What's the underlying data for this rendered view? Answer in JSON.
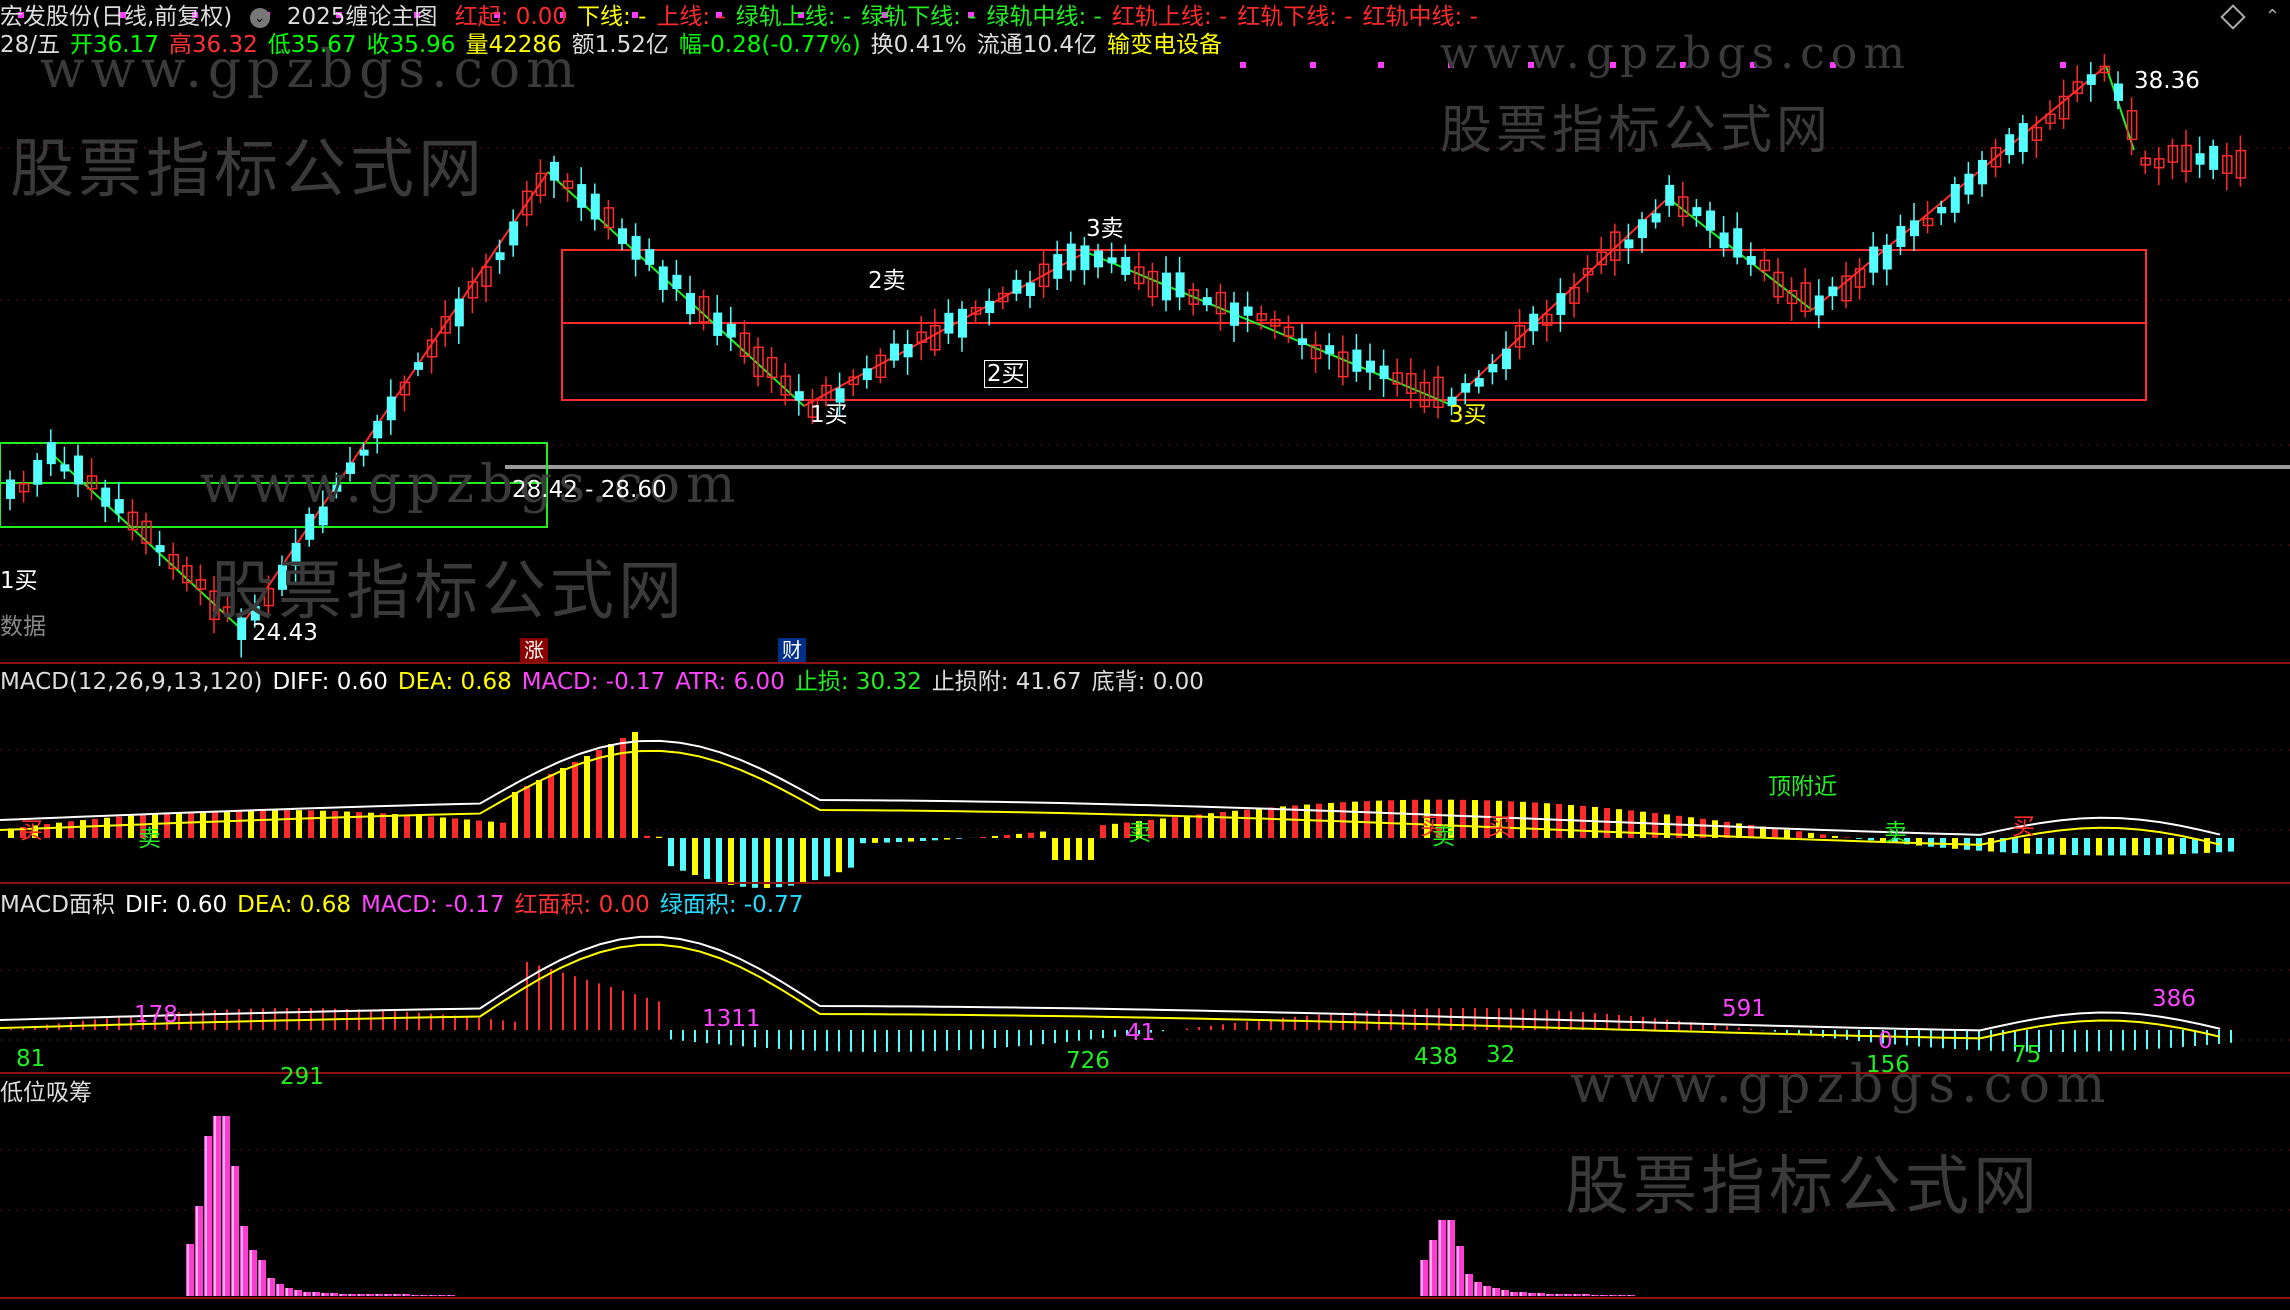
{
  "title_bar": {
    "stock_name": "宏发股份(日线,前复权)",
    "indicator": "2025缠论主图",
    "params": [
      {
        "text": "红起: 0.00",
        "color": "#ff2a2a"
      },
      {
        "text": "下线: -",
        "color": "#ffff00"
      },
      {
        "text": "上线: -",
        "color": "#ff2a2a"
      },
      {
        "text": "绿轨上线: -",
        "color": "#22ee22"
      },
      {
        "text": "绿轨下线: -",
        "color": "#22ee22"
      },
      {
        "text": "绿轨中线: -",
        "color": "#22ee22"
      },
      {
        "text": "红轨上线: -",
        "color": "#ff2a2a"
      },
      {
        "text": "红轨下线: -",
        "color": "#ff2a2a"
      },
      {
        "text": "红轨中线: -",
        "color": "#ff2a2a"
      }
    ]
  },
  "quote_bar": [
    {
      "text": "28/五",
      "color": "#dddddd"
    },
    {
      "text": "开36.17",
      "color": "#00ff00"
    },
    {
      "text": "高36.32",
      "color": "#ff3333"
    },
    {
      "text": "低35.67",
      "color": "#00ff00"
    },
    {
      "text": "收35.96",
      "color": "#00ff00"
    },
    {
      "text": "量42286",
      "color": "#ffff00"
    },
    {
      "text": "额1.52亿",
      "color": "#dddddd"
    },
    {
      "text": "幅-0.28(-0.77%)",
      "color": "#00ff00"
    },
    {
      "text": "换0.41%",
      "color": "#dddddd"
    },
    {
      "text": "流通10.4亿",
      "color": "#dddddd"
    },
    {
      "text": "输变电设备",
      "color": "#ffff00"
    }
  ],
  "main_chart": {
    "price_labels": {
      "high": "38.36",
      "low": "24.43",
      "zone": "28.42 - 28.60"
    },
    "signals": [
      "1买",
      "2卖",
      "2买",
      "3卖",
      "1买",
      "3买"
    ],
    "data_button": "数据",
    "event_tags": {
      "zhang": "涨",
      "cai": "财"
    }
  },
  "macd_pane": {
    "items": [
      {
        "text": "MACD(12,26,9,13,120)",
        "color": "#dddddd"
      },
      {
        "text": "DIFF: 0.60",
        "color": "#ffffff"
      },
      {
        "text": "DEA: 0.68",
        "color": "#ffff00"
      },
      {
        "text": "MACD: -0.17",
        "color": "#ff44ff"
      },
      {
        "text": "ATR: 6.00",
        "color": "#ff44ff"
      },
      {
        "text": "止损: 30.32",
        "color": "#22ee22"
      },
      {
        "text": "止损附: 41.67",
        "color": "#dddddd"
      },
      {
        "text": "底背: 0.00",
        "color": "#dddddd"
      }
    ],
    "signals": [
      "买",
      "卖",
      "卖",
      "买",
      "卖",
      "买",
      "买",
      "顶附近",
      "卖",
      "买"
    ]
  },
  "area_pane": {
    "items": [
      {
        "text": "MACD面积",
        "color": "#dddddd"
      },
      {
        "text": "DIF: 0.60",
        "color": "#ffffff"
      },
      {
        "text": "DEA: 0.68",
        "color": "#ffff00"
      },
      {
        "text": "MACD: -0.17",
        "color": "#ff44ff"
      },
      {
        "text": "红面积: 0.00",
        "color": "#ff3333"
      },
      {
        "text": "绿面积: -0.77",
        "color": "#22ddff"
      }
    ],
    "area_values": [
      "81",
      "178",
      "291",
      "1311",
      "726",
      "41",
      "438",
      "32",
      "591",
      "0",
      "156",
      "75",
      "386"
    ]
  },
  "chip_pane": {
    "title": "低位吸筹"
  },
  "watermarks": {
    "url": "www.gpzbgs.com",
    "cn": "股票指标公式网"
  },
  "colors": {
    "up": "#ff2a2a",
    "down": "#54ffff",
    "green_line": "#22ee22",
    "red_line": "#ff2a2a",
    "magenta": "#ff3cff"
  }
}
